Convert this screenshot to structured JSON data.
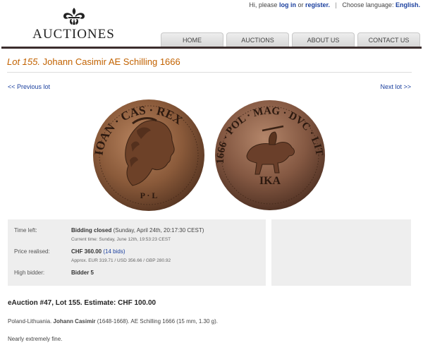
{
  "topbar": {
    "greeting": "Hi, please",
    "login": "log in",
    "or": "or",
    "register": "register.",
    "separator": "|",
    "choose_language": "Choose language:",
    "language": "English."
  },
  "logo": {
    "text": "AUCTIONES"
  },
  "nav": {
    "items": [
      "HOME",
      "AUCTIONS",
      "ABOUT US",
      "CONTACT US"
    ]
  },
  "lot": {
    "number_label": "Lot 155.",
    "title": "Johann Casimir AE Schilling 1666",
    "prev": "<< Previous lot",
    "next": "Next lot >>"
  },
  "bidding": {
    "time_left_label": "Time left:",
    "status": "Bidding closed",
    "closed_detail": "(Sunday, April 24th, 20:17:30 CEST)",
    "current_time": "Current time: Sunday, June 12th, 19:53:23 CEST",
    "price_label": "Price realised:",
    "price": "CHF 360.00",
    "bids": "(14 bids)",
    "approx": "Approx. EUR 319.71 / USD 356.66 / GBP 280.92",
    "high_bidder_label": "High bidder:",
    "high_bidder": "Bidder 5"
  },
  "description": {
    "heading": "eAuction #47, Lot 155. Estimate: CHF 100.00",
    "origin": "Poland-Lithuania.",
    "ruler": "Johann Casimir",
    "details": "(1648-1668). AE Schilling 1666 (15 mm, 1.30 g).",
    "grade": "Nearly extremely fine."
  },
  "colors": {
    "title_orange": "#c26200",
    "link_blue": "#1a3f9e",
    "nav_rule": "#3b2d2d",
    "coin_bronze": "#8a5a3a"
  },
  "coin": {
    "obverse_legend": "IOAN · CAS · REX",
    "obverse_legend_lower": "P · L",
    "reverse_legend": "1666 · POL · MAG · DVC · LIT",
    "reverse_monogram": "IKA"
  }
}
